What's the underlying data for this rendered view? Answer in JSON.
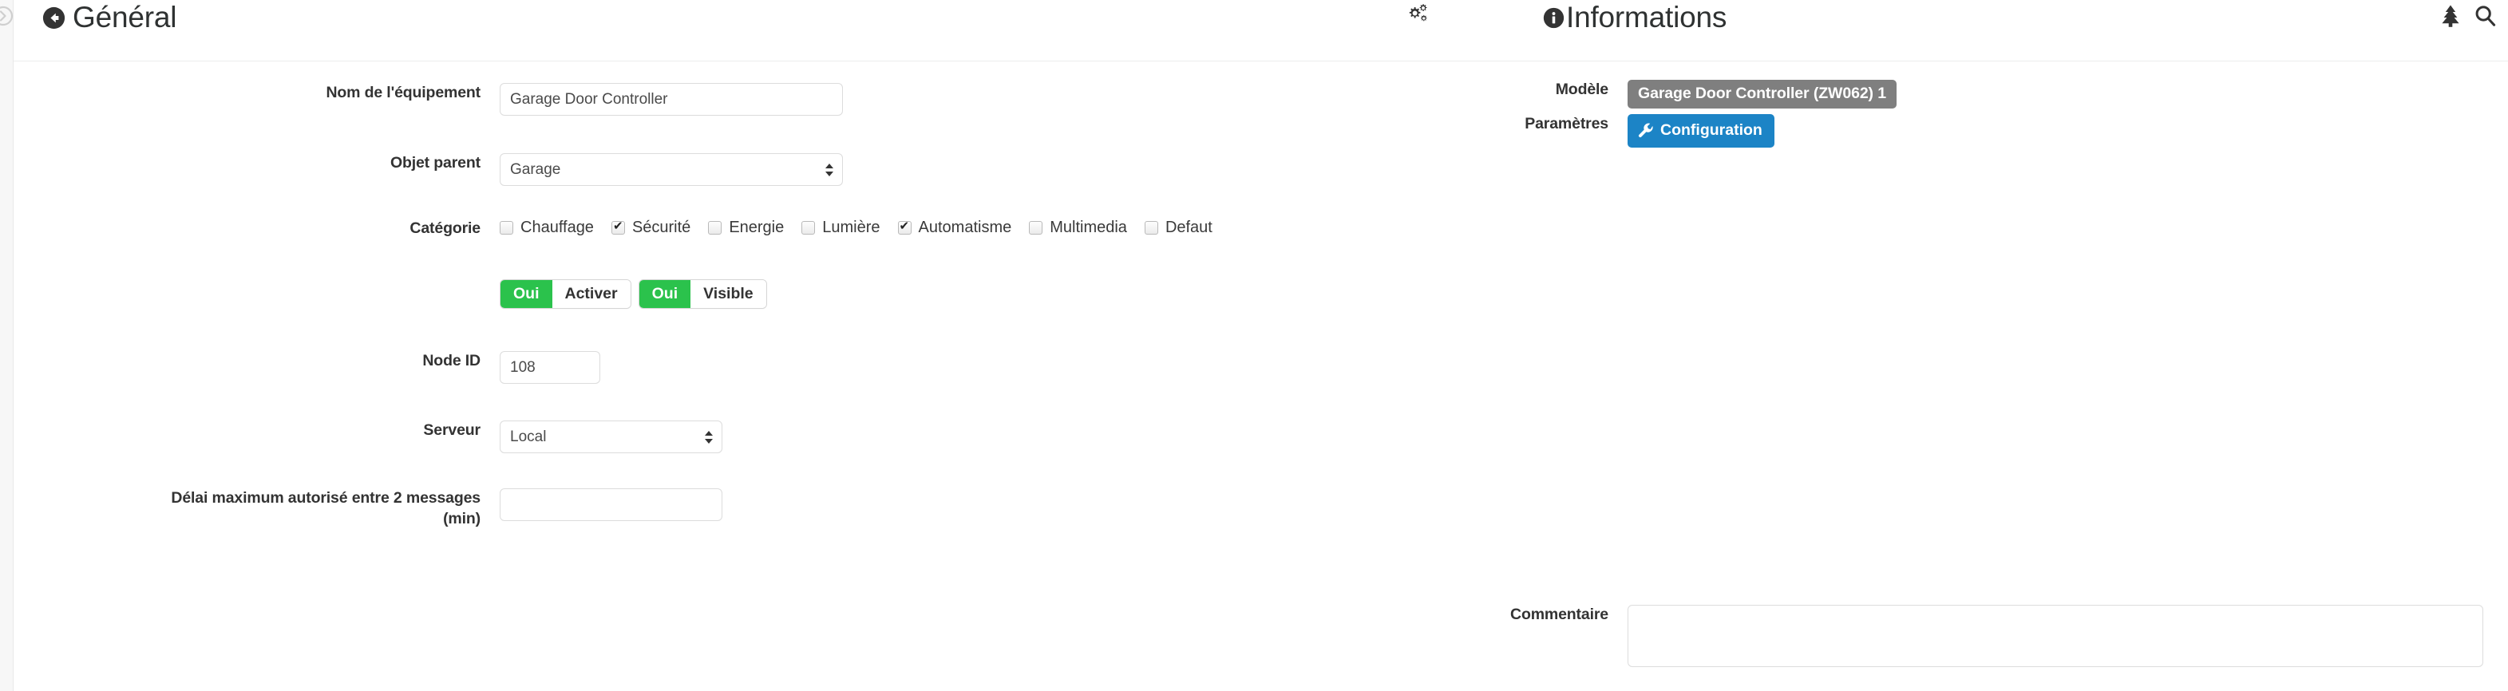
{
  "theme": {
    "green": "#2bc24c",
    "blue": "#1c84c6",
    "grey_badge": "#7f7f7f",
    "text": "#333333",
    "border": "#dcdcdc"
  },
  "left_panel": {
    "title": "Général",
    "back_icon": "arrow-circle-left-icon",
    "cogs_icon": "cogs-icon",
    "fields": {
      "name": {
        "label": "Nom de l'équipement",
        "value": "Garage Door Controller",
        "placeholder": ""
      },
      "parent": {
        "label": "Objet parent",
        "value": "Garage",
        "options": [
          "Garage"
        ]
      },
      "category": {
        "label": "Catégorie",
        "items": [
          {
            "label": "Chauffage",
            "checked": false
          },
          {
            "label": "Sécurité",
            "checked": true
          },
          {
            "label": "Energie",
            "checked": false
          },
          {
            "label": "Lumière",
            "checked": false
          },
          {
            "label": "Automatisme",
            "checked": true
          },
          {
            "label": "Multimedia",
            "checked": false
          },
          {
            "label": "Defaut",
            "checked": false
          }
        ]
      },
      "toggles": [
        {
          "state_label": "Oui",
          "name_label": "Activer",
          "active": true
        },
        {
          "state_label": "Oui",
          "name_label": "Visible",
          "active": true
        }
      ],
      "node_id": {
        "label": "Node ID",
        "value": "108",
        "placeholder": ""
      },
      "server": {
        "label": "Serveur",
        "value": "Local",
        "options": [
          "Local"
        ]
      },
      "timeout": {
        "label_line1": "Délai maximum autorisé entre 2 messages",
        "label_line2": "(min)",
        "value": "",
        "placeholder": ""
      }
    }
  },
  "right_panel": {
    "title": "Informations",
    "info_icon": "info-circle-icon",
    "tree_icon": "tree-icon",
    "search_icon": "search-icon",
    "fields": {
      "model": {
        "label": "Modèle",
        "value": "Garage Door Controller (ZW062) 1"
      },
      "parameters": {
        "label": "Paramètres",
        "button_label": "Configuration",
        "button_icon": "wrench-icon"
      },
      "comment": {
        "label": "Commentaire",
        "value": "",
        "placeholder": ""
      }
    },
    "product_image_alt": "garage-door-controller-device-photo"
  }
}
